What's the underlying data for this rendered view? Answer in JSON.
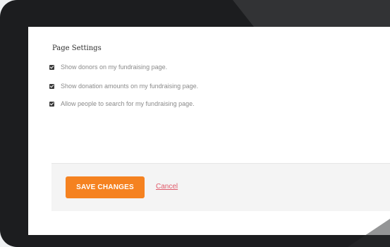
{
  "settings": {
    "title": "Page Settings",
    "options": [
      {
        "label": "Show donors on my fundraising page.",
        "checked": true
      },
      {
        "label": "Show donation amounts on my fundraising page.",
        "checked": true
      },
      {
        "label": "Allow people to search for my fundraising page.",
        "checked": true
      }
    ]
  },
  "actions": {
    "save_label": "SAVE CHANGES",
    "cancel_label": "Cancel"
  },
  "colors": {
    "accent": "#f58220",
    "cancel_link": "#e05a6a",
    "bezel": "#1c1d1f"
  }
}
